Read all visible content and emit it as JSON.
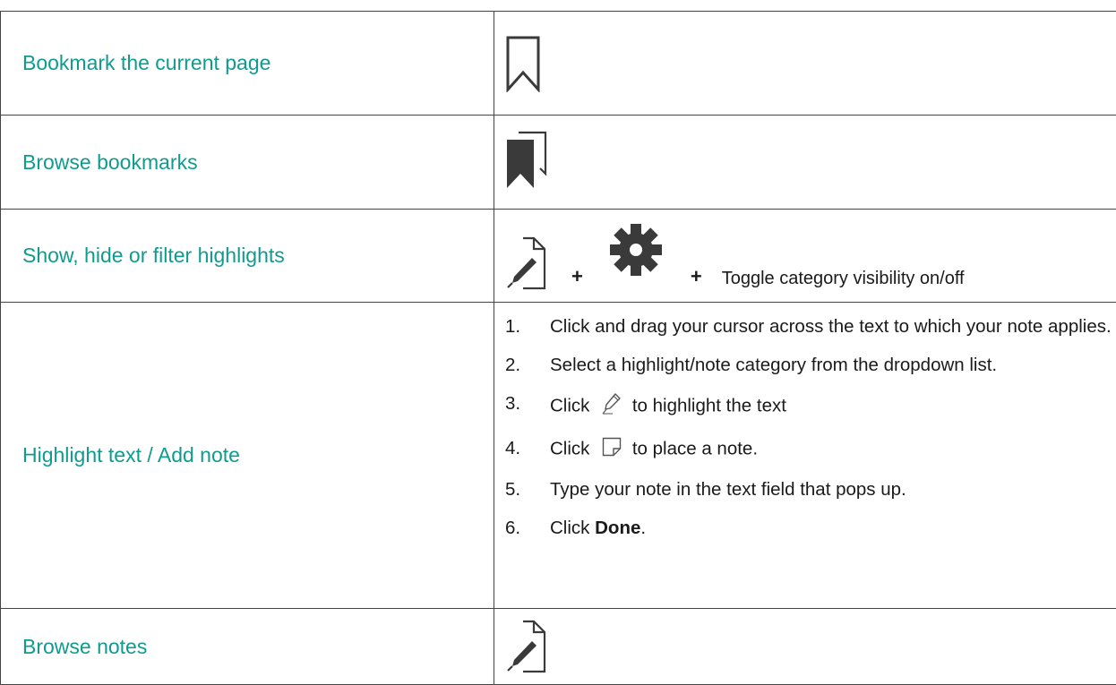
{
  "rows": {
    "bookmark": {
      "label": "Bookmark the current page",
      "icon": "bookmark-outline-icon"
    },
    "browse_bookmarks": {
      "label": "Browse bookmarks",
      "icon": "bookmarks-stack-icon"
    },
    "highlights": {
      "label": "Show, hide or filter highlights",
      "icons": [
        "document-pen-icon",
        "gear-icon"
      ],
      "plus": "+",
      "toggle_text": "Toggle category visibility on/off"
    },
    "highlight_text": {
      "label": "Highlight text / Add note",
      "steps": [
        {
          "num": "1.",
          "text": "Click and drag your cursor across the text to which your note applies."
        },
        {
          "num": "2.",
          "text": "Select a highlight/note category from the dropdown list."
        },
        {
          "num": "3.",
          "pre": "Click",
          "icon": "highlighter-pen-icon",
          "post": "to highlight the text"
        },
        {
          "num": "4.",
          "pre": "Click",
          "icon": "note-icon",
          "post": "to place a note."
        },
        {
          "num": "5.",
          "text": "Type your note in the text field that pops up."
        },
        {
          "num": "6.",
          "pre": "Click",
          "bold": "Done",
          "post": "."
        }
      ]
    },
    "browse_notes": {
      "label": "Browse notes",
      "icon": "document-pen-icon"
    }
  },
  "colors": {
    "label": "#0f9b8e",
    "icon": "#3a3a3a",
    "border": "#444444"
  }
}
